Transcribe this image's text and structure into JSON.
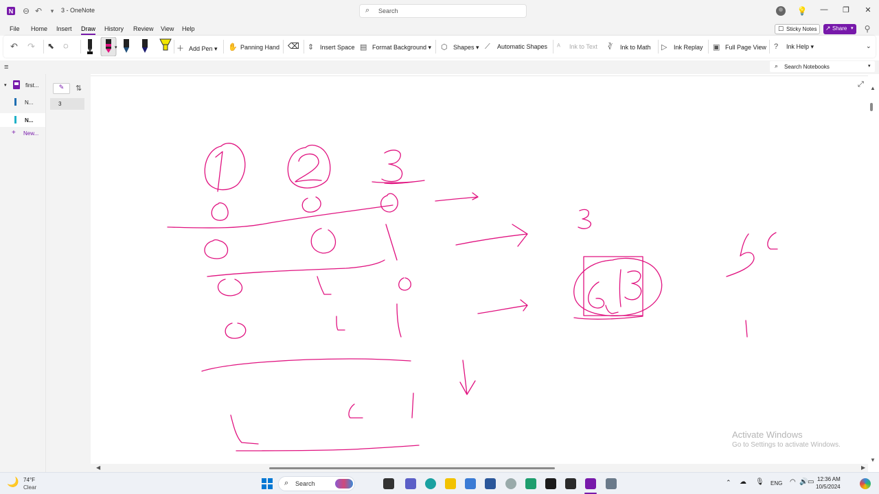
{
  "window": {
    "title": "3 - OneNote",
    "search_placeholder": "Search"
  },
  "menu": {
    "items": [
      "File",
      "Home",
      "Insert",
      "Draw",
      "History",
      "Review",
      "View",
      "Help"
    ],
    "active": "Draw",
    "sticky_notes": "Sticky Notes",
    "share": "Share"
  },
  "ribbon": {
    "add_pen": "Add Pen",
    "panning_hand": "Panning Hand",
    "insert_space": "Insert Space",
    "format_background": "Format Background",
    "shapes": "Shapes",
    "automatic_shapes": "Automatic Shapes",
    "ink_to_text": "Ink to Text",
    "ink_to_math": "Ink to Math",
    "ink_replay": "Ink Replay",
    "full_page_view": "Full Page View",
    "ink_help": "Ink Help",
    "pen_colors": [
      "#111111",
      "#e0117f",
      "#1f4e79",
      "#1a1a6e",
      "#f2e600"
    ]
  },
  "notebooks": {
    "search_placeholder": "Search Notebooks",
    "notebook_name": "first...",
    "sections": [
      {
        "label": "N...",
        "color": "#1f6fb2"
      },
      {
        "label": "N...",
        "color": "#20b2c8"
      }
    ],
    "new_section": "New..."
  },
  "pages": {
    "items": [
      "3"
    ]
  },
  "watermark": {
    "line1": "Activate Windows",
    "line2": "Go to Settings to activate Windows."
  },
  "taskbar": {
    "weather_temp": "74°F",
    "weather_cond": "Clear",
    "search": "Search",
    "lang": "ENG",
    "time": "12:36 AM",
    "date": "10/5/2024"
  },
  "colors": {
    "accent": "#7719aa",
    "ink": "#e0117f"
  }
}
